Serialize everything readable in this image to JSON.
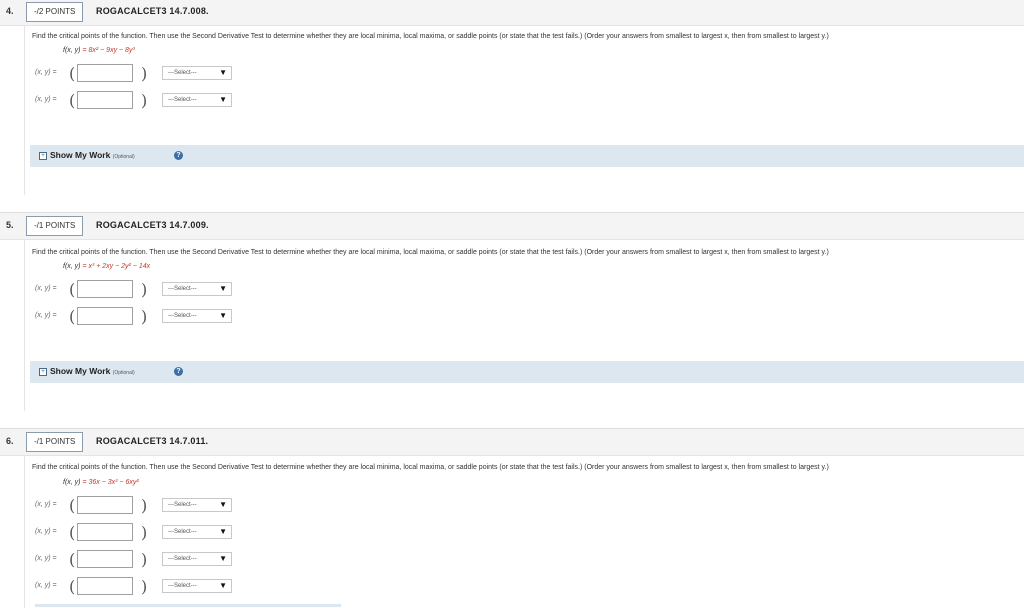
{
  "questions": [
    {
      "number": "4.",
      "points": "-/2 POINTS",
      "code": "ROGACALCET3 14.7.008.",
      "prompt": "Find the critical points of the function. Then use the Second Derivative Test to determine whether they are local minima, local maxima, or saddle points (or state that the test fails.) (Order your answers from smallest to largest x, then from smallest to largest y.)",
      "formula_lhs": "f(x, y)",
      "formula_eq": " = ",
      "formula_rhs": "8x² − 9xy − 8y³",
      "answers": [
        {
          "label": "(x, y) =",
          "value": "",
          "select": "---Select---"
        },
        {
          "label": "(x, y) =",
          "value": "",
          "select": "---Select---"
        }
      ],
      "show_work": {
        "label": "Show My Work",
        "optional": "(Optional)",
        "help": "?"
      }
    },
    {
      "number": "5.",
      "points": "-/1 POINTS",
      "code": "ROGACALCET3 14.7.009.",
      "prompt": "Find the critical points of the function. Then use the Second Derivative Test to determine whether they are local minima, local maxima, or saddle points (or state that the test fails.) (Order your answers from smallest to largest x, then from smallest to largest y.)",
      "formula_lhs": "f(x, y)",
      "formula_eq": " = ",
      "formula_rhs": "x³ + 2xy − 2y² − 14x",
      "answers": [
        {
          "label": "(x, y) =",
          "value": "",
          "select": "---Select---"
        },
        {
          "label": "(x, y) =",
          "value": "",
          "select": "---Select---"
        }
      ],
      "show_work": {
        "label": "Show My Work",
        "optional": "(Optional)",
        "help": "?"
      }
    },
    {
      "number": "6.",
      "points": "-/1 POINTS",
      "code": "ROGACALCET3 14.7.011.",
      "prompt": "Find the critical points of the function. Then use the Second Derivative Test to determine whether they are local minima, local maxima, or saddle points (or state that the test fails.) (Order your answers from smallest to largest x, then from smallest to largest y.)",
      "formula_lhs": "f(x, y)",
      "formula_eq": " = ",
      "formula_rhs": "36x − 3x³ − 6xy²",
      "answers": [
        {
          "label": "(x, y) =",
          "value": "",
          "select": "---Select---"
        },
        {
          "label": "(x, y) =",
          "value": "",
          "select": "---Select---"
        },
        {
          "label": "(x, y) =",
          "value": "",
          "select": "---Select---"
        },
        {
          "label": "(x, y) =",
          "value": "",
          "select": "---Select---"
        }
      ]
    }
  ],
  "icons": {
    "toggle": "plus-box-icon",
    "help": "help-circle-icon",
    "dropdown": "triangle-down-icon"
  },
  "colors": {
    "header_bg": "#f4f4f4",
    "show_work_bg": "#dde7ef",
    "formula_accent": "#c0392b",
    "help_icon": "#3a6fa8"
  }
}
